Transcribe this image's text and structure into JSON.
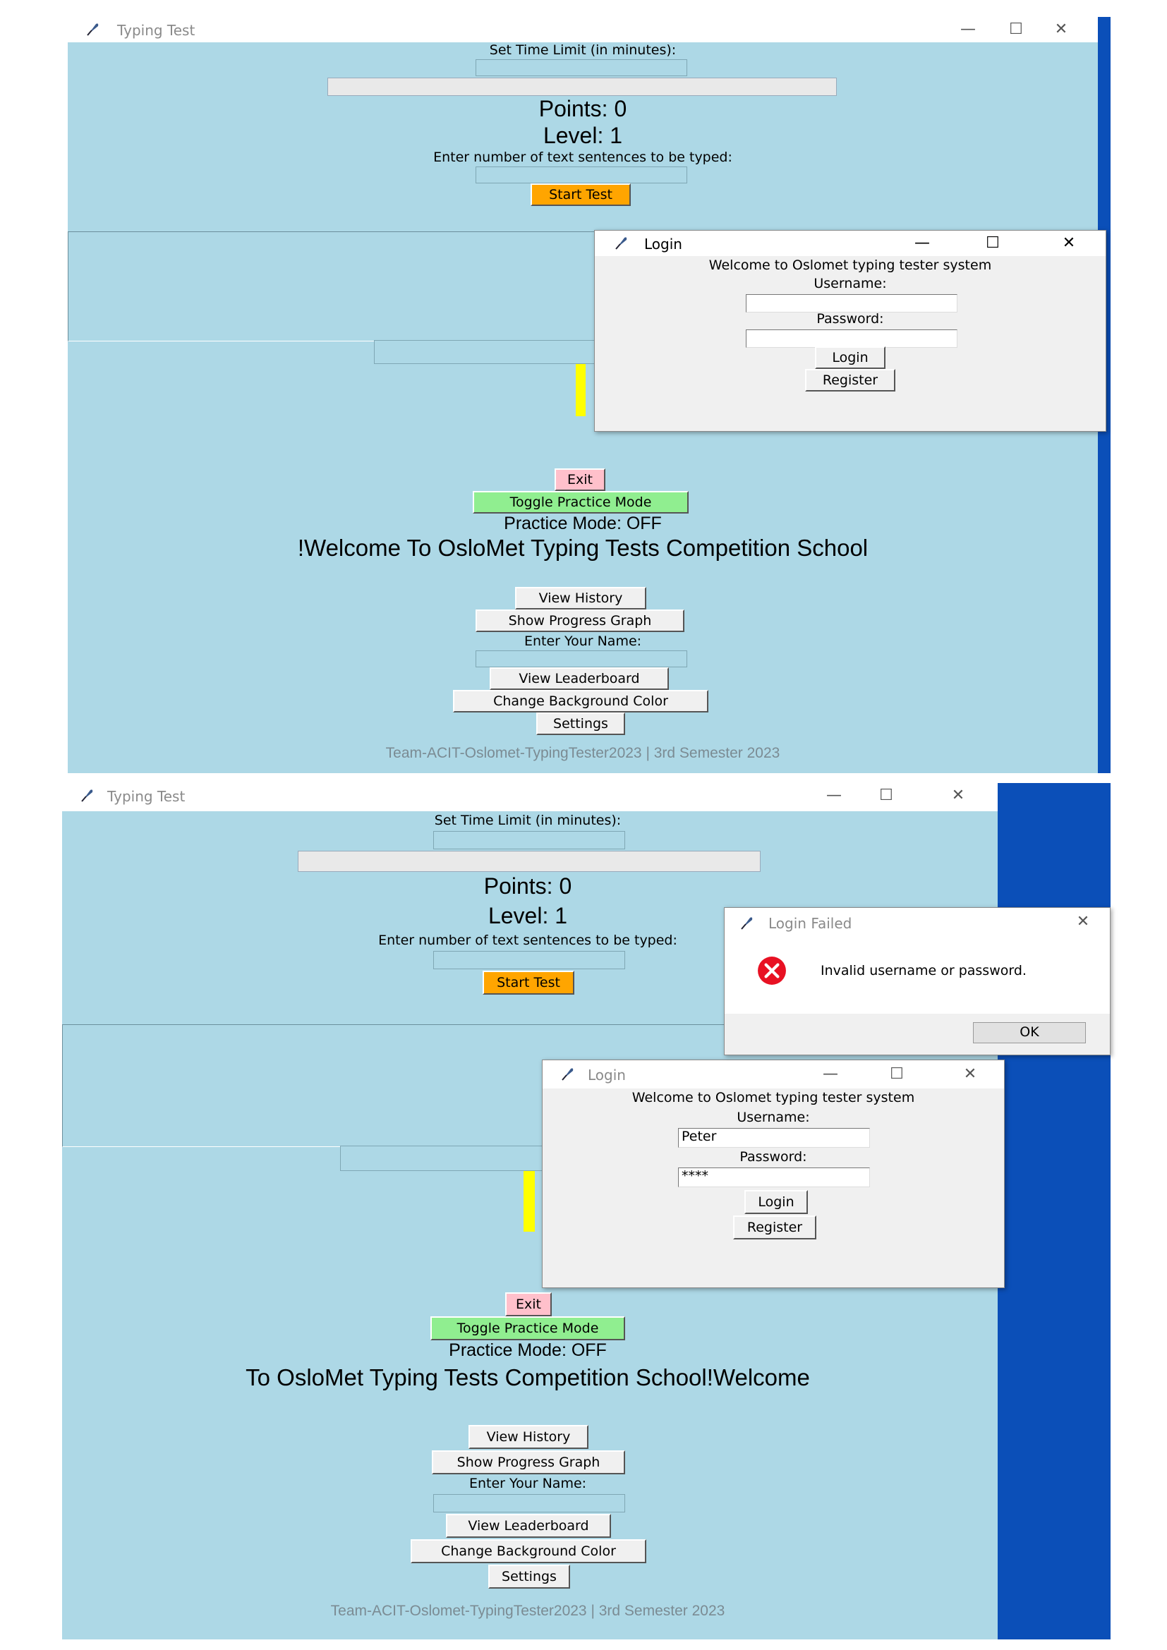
{
  "windows": [
    {
      "title": "Typing Test",
      "controls": [
        "—",
        "☐",
        "✕"
      ],
      "time_limit_label": "Set Time Limit (in minutes):",
      "points": "Points: 0",
      "level": "Level: 1",
      "sentences_label": "Enter number of text sentences to be typed:",
      "start_button": "Start Test",
      "exit_button": "Exit",
      "toggle_button": "Toggle Practice Mode",
      "practice_status": "Practice Mode: OFF",
      "welcome": "!Welcome To OsloMet Typing Tests Competition School",
      "view_history": "View History",
      "progress_graph": "Show Progress Graph",
      "name_label": "Enter Your Name:",
      "leaderboard": "View Leaderboard",
      "change_bg": "Change Background Color",
      "settings": "Settings",
      "footer": "Team-ACIT-Oslomet-TypingTester2023 | 3rd Semester 2023"
    },
    {
      "title": "Typing Test",
      "controls": [
        "—",
        "☐",
        "✕"
      ],
      "time_limit_label": "Set Time Limit (in minutes):",
      "points": "Points: 0",
      "level": "Level: 1",
      "sentences_label": "Enter number of text sentences to be typed:",
      "start_button": "Start Test",
      "exit_button": "Exit",
      "toggle_button": "Toggle Practice Mode",
      "practice_status": "Practice Mode: OFF",
      "welcome": "To OsloMet Typing Tests Competition School!Welcome",
      "view_history": "View History",
      "progress_graph": "Show Progress Graph",
      "name_label": "Enter Your Name:",
      "leaderboard": "View Leaderboard",
      "change_bg": "Change Background Color",
      "settings": "Settings",
      "footer": "Team-ACIT-Oslomet-TypingTester2023 | 3rd Semester 2023"
    }
  ],
  "login_dialogs": [
    {
      "title": "Login",
      "welcome": "Welcome to Oslomet typing tester system",
      "username_label": "Username:",
      "username_value": "",
      "password_label": "Password:",
      "password_value": "",
      "login_button": "Login",
      "register_button": "Register"
    },
    {
      "title": "Login",
      "welcome": "Welcome to Oslomet typing tester system",
      "username_label": "Username:",
      "username_value": "Peter",
      "password_label": "Password:",
      "password_value": "****",
      "login_button": "Login",
      "register_button": "Register"
    }
  ],
  "error_dialog": {
    "title": "Login Failed",
    "message": "Invalid username or password.",
    "ok_button": "OK",
    "close": "✕"
  },
  "colors": {
    "window_bg": "#add8e6",
    "start_button": "#ffa500",
    "exit_button": "#ffc0cb",
    "toggle_button": "#90ee90",
    "cursor_bar": "#ffff00",
    "desktop_edge": "#0b4fb8",
    "error_icon": "#e81123"
  }
}
